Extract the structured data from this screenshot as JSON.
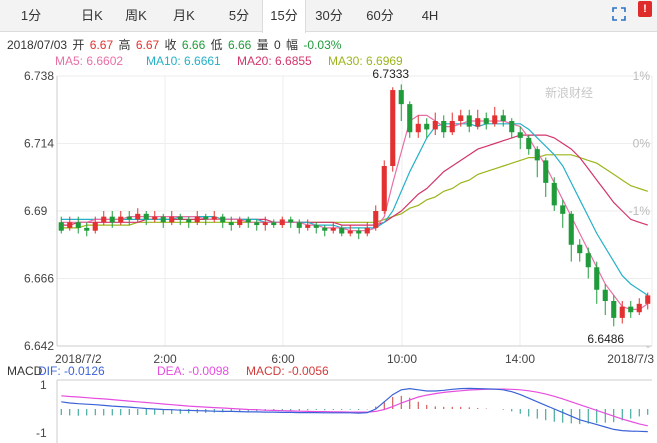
{
  "tabs": [
    {
      "label": "1分",
      "active": false
    },
    {
      "label": "日K",
      "active": false
    },
    {
      "label": "周K",
      "active": false
    },
    {
      "label": "月K",
      "active": false
    },
    {
      "label": "5分",
      "active": false
    },
    {
      "label": "15分",
      "active": true
    },
    {
      "label": "30分",
      "active": false
    },
    {
      "label": "60分",
      "active": false
    },
    {
      "label": "4H",
      "active": false
    }
  ],
  "icons": {
    "fullscreen": "expand-icon",
    "info": "info-icon",
    "info_glyph": "!"
  },
  "quote": {
    "date": "2018/07/03",
    "open_label": "开",
    "open": "6.67",
    "high_label": "高",
    "high": "6.67",
    "close_label": "收",
    "close": "6.66",
    "low_label": "低",
    "low": "6.66",
    "volume_label": "量",
    "volume": "0",
    "change_label": "幅",
    "change": "-0.03%"
  },
  "ma": [
    {
      "label": "MA5: 6.6602",
      "color": "#e86fa6"
    },
    {
      "label": "MA10: 6.6661",
      "color": "#25b0c9"
    },
    {
      "label": "MA20: 6.6855",
      "color": "#d2356a"
    },
    {
      "label": "MA30: 6.6969",
      "color": "#9cb51c"
    }
  ],
  "colors": {
    "up": "#e33030",
    "down": "#1f9b3a",
    "grid": "#eeeeee",
    "axis": "#cccccc",
    "dif": "#3b63d8",
    "dea": "#e64ee0",
    "macd_bar": "#1f9b8a"
  },
  "chart_data": {
    "type": "candlestick",
    "y_ticks": [
      "6.738",
      "6.714",
      "6.69",
      "6.666",
      "6.642"
    ],
    "ylim": [
      6.642,
      6.738
    ],
    "pct_ticks": [
      "1%",
      "0%",
      "-1%",
      "",
      "-"
    ],
    "x_ticks": [
      "2018/7/2",
      "2:00",
      "6:00",
      "10:00",
      "14:00",
      "2018/7/3"
    ],
    "annotations": [
      "6.7333",
      "6.6486"
    ],
    "watermark": "新浪财经",
    "candles": [
      [
        6.686,
        6.683,
        6.688,
        6.682
      ],
      [
        6.684,
        6.686,
        6.688,
        6.683
      ],
      [
        6.686,
        6.684,
        6.688,
        6.682
      ],
      [
        6.684,
        6.683,
        6.686,
        6.681
      ],
      [
        6.683,
        6.686,
        6.688,
        6.682
      ],
      [
        6.686,
        6.688,
        6.69,
        6.685
      ],
      [
        6.688,
        6.686,
        6.69,
        6.684
      ],
      [
        6.686,
        6.688,
        6.69,
        6.685
      ],
      [
        6.688,
        6.687,
        6.69,
        6.685
      ],
      [
        6.687,
        6.689,
        6.691,
        6.686
      ],
      [
        6.689,
        6.687,
        6.69,
        6.685
      ],
      [
        6.687,
        6.688,
        6.69,
        6.686
      ],
      [
        6.688,
        6.686,
        6.689,
        6.684
      ],
      [
        6.686,
        6.688,
        6.69,
        6.685
      ],
      [
        6.688,
        6.687,
        6.689,
        6.685
      ],
      [
        6.687,
        6.686,
        6.688,
        6.684
      ],
      [
        6.686,
        6.688,
        6.69,
        6.685
      ],
      [
        6.688,
        6.687,
        6.689,
        6.685
      ],
      [
        6.687,
        6.688,
        6.69,
        6.686
      ],
      [
        6.688,
        6.686,
        6.689,
        6.684
      ],
      [
        6.686,
        6.685,
        6.688,
        6.683
      ],
      [
        6.685,
        6.687,
        6.688,
        6.684
      ],
      [
        6.687,
        6.686,
        6.688,
        6.684
      ],
      [
        6.686,
        6.685,
        6.687,
        6.683
      ],
      [
        6.685,
        6.686,
        6.688,
        6.683
      ],
      [
        6.686,
        6.685,
        6.687,
        6.684
      ],
      [
        6.685,
        6.687,
        6.688,
        6.684
      ],
      [
        6.687,
        6.686,
        6.688,
        6.684
      ],
      [
        6.686,
        6.684,
        6.687,
        6.682
      ],
      [
        6.684,
        6.685,
        6.687,
        6.683
      ],
      [
        6.685,
        6.684,
        6.686,
        6.682
      ],
      [
        6.684,
        6.683,
        6.685,
        6.681
      ],
      [
        6.683,
        6.684,
        6.686,
        6.682
      ],
      [
        6.684,
        6.682,
        6.685,
        6.681
      ],
      [
        6.682,
        6.683,
        6.685,
        6.681
      ],
      [
        6.683,
        6.682,
        6.684,
        6.68
      ],
      [
        6.682,
        6.684,
        6.686,
        6.681
      ],
      [
        6.684,
        6.69,
        6.692,
        6.683
      ],
      [
        6.69,
        6.706,
        6.708,
        6.689
      ],
      [
        6.706,
        6.733,
        6.734,
        6.704
      ],
      [
        6.733,
        6.728,
        6.735,
        6.722
      ],
      [
        6.728,
        6.718,
        6.729,
        6.716
      ],
      [
        6.718,
        6.721,
        6.724,
        6.716
      ],
      [
        6.721,
        6.719,
        6.723,
        6.716
      ],
      [
        6.719,
        6.722,
        6.725,
        6.717
      ],
      [
        6.722,
        6.718,
        6.724,
        6.716
      ],
      [
        6.718,
        6.722,
        6.725,
        6.717
      ],
      [
        6.722,
        6.724,
        6.726,
        6.72
      ],
      [
        6.724,
        6.72,
        6.726,
        6.718
      ],
      [
        6.72,
        6.723,
        6.726,
        6.719
      ],
      [
        6.723,
        6.721,
        6.725,
        6.719
      ],
      [
        6.721,
        6.724,
        6.727,
        6.72
      ],
      [
        6.724,
        6.722,
        6.726,
        6.72
      ],
      [
        6.722,
        6.718,
        6.723,
        6.716
      ],
      [
        6.718,
        6.716,
        6.72,
        6.712
      ],
      [
        6.716,
        6.712,
        6.717,
        6.71
      ],
      [
        6.712,
        6.708,
        6.713,
        6.702
      ],
      [
        6.708,
        6.7,
        6.709,
        6.695
      ],
      [
        6.7,
        6.692,
        6.702,
        6.69
      ],
      [
        6.692,
        6.689,
        6.694,
        6.684
      ],
      [
        6.689,
        6.678,
        6.69,
        6.672
      ],
      [
        6.678,
        6.675,
        6.68,
        6.672
      ],
      [
        6.675,
        6.67,
        6.677,
        6.666
      ],
      [
        6.67,
        6.662,
        6.672,
        6.657
      ],
      [
        6.662,
        6.658,
        6.664,
        6.653
      ],
      [
        6.658,
        6.652,
        6.66,
        6.649
      ],
      [
        6.652,
        6.656,
        6.658,
        6.65
      ],
      [
        6.656,
        6.654,
        6.658,
        6.652
      ],
      [
        6.654,
        6.657,
        6.659,
        6.653
      ],
      [
        6.657,
        6.66,
        6.661,
        6.655
      ]
    ],
    "ma5": [
      6.686,
      6.686,
      6.686,
      6.686,
      6.687,
      6.687,
      6.687,
      6.687,
      6.688,
      6.688,
      6.688,
      6.688,
      6.688,
      6.688,
      6.688,
      6.688,
      6.688,
      6.687,
      6.687,
      6.687,
      6.687,
      6.687,
      6.686,
      6.686,
      6.686,
      6.686,
      6.686,
      6.686,
      6.686,
      6.685,
      6.685,
      6.684,
      6.684,
      6.684,
      6.683,
      6.683,
      6.683,
      6.684,
      6.688,
      6.7,
      6.711,
      6.722,
      6.724,
      6.724,
      6.722,
      6.72,
      6.72,
      6.721,
      6.722,
      6.722,
      6.722,
      6.722,
      6.722,
      6.721,
      6.72,
      6.716,
      6.711,
      6.706,
      6.7,
      6.694,
      6.688,
      6.682,
      6.676,
      6.67,
      6.664,
      6.66,
      6.656,
      6.655,
      6.655,
      6.657
    ],
    "ma10": [
      6.687,
      6.687,
      6.687,
      6.687,
      6.687,
      6.687,
      6.687,
      6.687,
      6.687,
      6.687,
      6.687,
      6.687,
      6.687,
      6.687,
      6.688,
      6.688,
      6.688,
      6.688,
      6.688,
      6.687,
      6.687,
      6.687,
      6.687,
      6.687,
      6.686,
      6.686,
      6.686,
      6.686,
      6.686,
      6.686,
      6.685,
      6.685,
      6.685,
      6.684,
      6.684,
      6.684,
      6.684,
      6.684,
      6.686,
      6.69,
      6.697,
      6.704,
      6.71,
      6.716,
      6.72,
      6.721,
      6.721,
      6.721,
      6.721,
      6.72,
      6.721,
      6.721,
      6.721,
      6.721,
      6.721,
      6.719,
      6.716,
      6.713,
      6.71,
      6.706,
      6.7,
      6.694,
      6.688,
      6.682,
      6.677,
      6.672,
      6.667,
      6.664,
      6.662,
      6.66
    ],
    "ma20": [
      6.685,
      6.685,
      6.686,
      6.686,
      6.686,
      6.686,
      6.686,
      6.686,
      6.686,
      6.686,
      6.687,
      6.687,
      6.687,
      6.687,
      6.687,
      6.687,
      6.687,
      6.687,
      6.687,
      6.687,
      6.687,
      6.687,
      6.687,
      6.687,
      6.687,
      6.686,
      6.686,
      6.686,
      6.686,
      6.686,
      6.686,
      6.686,
      6.686,
      6.685,
      6.685,
      6.685,
      6.685,
      6.685,
      6.686,
      6.688,
      6.69,
      6.693,
      6.696,
      6.698,
      6.701,
      6.704,
      6.706,
      6.708,
      6.71,
      6.712,
      6.713,
      6.714,
      6.715,
      6.716,
      6.717,
      6.717,
      6.717,
      6.717,
      6.716,
      6.714,
      6.712,
      6.709,
      6.705,
      6.701,
      6.697,
      6.693,
      6.69,
      6.687,
      6.686,
      6.685
    ],
    "ma30": [
      6.684,
      6.684,
      6.684,
      6.685,
      6.685,
      6.685,
      6.685,
      6.685,
      6.685,
      6.686,
      6.686,
      6.686,
      6.686,
      6.686,
      6.686,
      6.686,
      6.686,
      6.686,
      6.686,
      6.686,
      6.686,
      6.686,
      6.686,
      6.686,
      6.686,
      6.686,
      6.686,
      6.686,
      6.686,
      6.686,
      6.686,
      6.686,
      6.686,
      6.686,
      6.686,
      6.686,
      6.686,
      6.686,
      6.687,
      6.688,
      6.689,
      6.691,
      6.692,
      6.694,
      6.695,
      6.697,
      6.698,
      6.7,
      6.701,
      6.703,
      6.704,
      6.705,
      6.706,
      6.707,
      6.708,
      6.709,
      6.709,
      6.71,
      6.71,
      6.71,
      6.71,
      6.709,
      6.708,
      6.707,
      6.705,
      6.703,
      6.701,
      6.699,
      6.698,
      6.697
    ],
    "macd": {
      "label": "MACD",
      "dif_label": "DIF: -0.0126",
      "dea_label": "DEA: -0.0098",
      "macd_label": "MACD: -0.0056",
      "y_ticks": [
        "1",
        "-1"
      ],
      "dif": [
        0.3,
        0.25,
        0.22,
        0.2,
        0.18,
        0.15,
        0.12,
        0.1,
        0.08,
        0.05,
        0.02,
        0,
        -0.02,
        -0.03,
        -0.05,
        -0.06,
        -0.07,
        -0.08,
        -0.09,
        -0.1,
        -0.1,
        -0.11,
        -0.12,
        -0.12,
        -0.13,
        -0.13,
        -0.14,
        -0.14,
        -0.15,
        -0.15,
        -0.15,
        -0.16,
        -0.16,
        -0.16,
        -0.16,
        -0.17,
        -0.15,
        0,
        0.3,
        0.6,
        0.8,
        0.85,
        0.8,
        0.75,
        0.75,
        0.78,
        0.82,
        0.85,
        0.86,
        0.85,
        0.84,
        0.83,
        0.8,
        0.72,
        0.6,
        0.45,
        0.3,
        0.15,
        0,
        -0.15,
        -0.3,
        -0.45,
        -0.55,
        -0.65,
        -0.75,
        -0.85,
        -0.9,
        -0.92,
        -0.93,
        -0.94
      ],
      "dea": [
        0.55,
        0.52,
        0.5,
        0.47,
        0.44,
        0.42,
        0.39,
        0.36,
        0.33,
        0.3,
        0.27,
        0.24,
        0.21,
        0.18,
        0.15,
        0.12,
        0.1,
        0.08,
        0.06,
        0.04,
        0.02,
        0,
        -0.02,
        -0.03,
        -0.05,
        -0.06,
        -0.07,
        -0.08,
        -0.09,
        -0.1,
        -0.11,
        -0.11,
        -0.12,
        -0.12,
        -0.13,
        -0.13,
        -0.13,
        -0.1,
        -0.02,
        0.1,
        0.25,
        0.38,
        0.5,
        0.58,
        0.64,
        0.69,
        0.73,
        0.76,
        0.79,
        0.81,
        0.82,
        0.83,
        0.83,
        0.82,
        0.8,
        0.76,
        0.7,
        0.62,
        0.53,
        0.42,
        0.3,
        0.18,
        0.06,
        -0.06,
        -0.18,
        -0.3,
        -0.42,
        -0.52,
        -0.62,
        -0.7
      ],
      "bars": [
        -0.25,
        -0.27,
        -0.28,
        -0.27,
        -0.26,
        -0.27,
        -0.27,
        -0.26,
        -0.25,
        -0.25,
        -0.25,
        -0.24,
        -0.23,
        -0.21,
        -0.2,
        -0.18,
        -0.17,
        -0.16,
        -0.15,
        -0.14,
        -0.12,
        -0.11,
        -0.1,
        -0.09,
        -0.08,
        -0.07,
        -0.07,
        -0.06,
        -0.06,
        -0.05,
        -0.04,
        -0.05,
        -0.04,
        -0.04,
        -0.03,
        -0.04,
        -0.02,
        0.1,
        0.32,
        0.5,
        0.55,
        0.47,
        0.3,
        0.17,
        0.11,
        0.09,
        0.09,
        0.09,
        0.07,
        0.04,
        0.02,
        0,
        -0.03,
        -0.1,
        -0.2,
        -0.31,
        -0.4,
        -0.47,
        -0.53,
        -0.57,
        -0.6,
        -0.63,
        -0.61,
        -0.59,
        -0.57,
        -0.55,
        -0.48,
        -0.4,
        -0.31,
        -0.24
      ]
    }
  }
}
